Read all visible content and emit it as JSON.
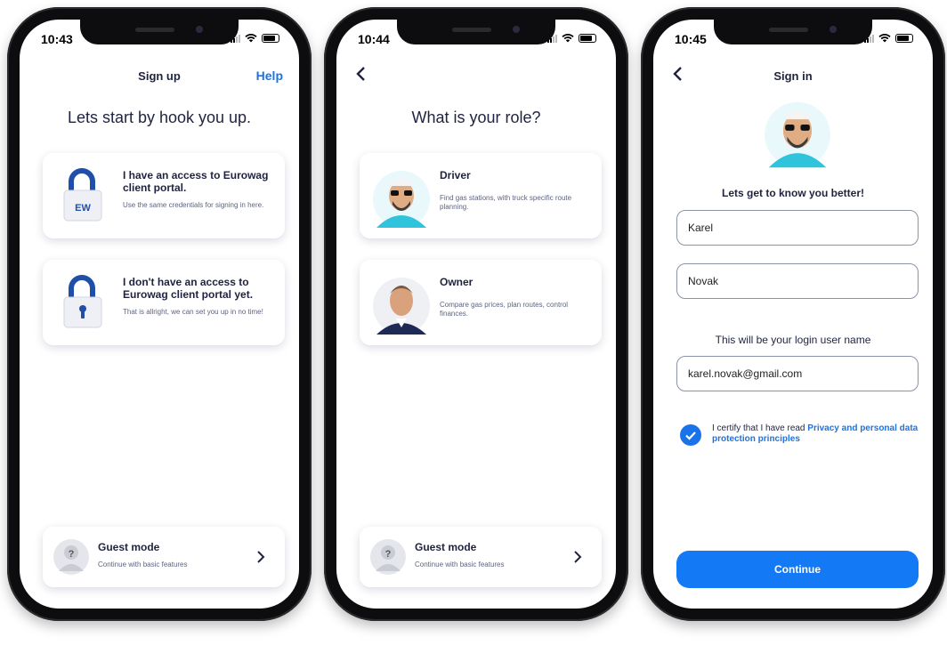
{
  "screens": [
    {
      "time": "10:43",
      "nav_title": "Sign up",
      "help": "Help",
      "heading": "Lets start by hook you up.",
      "cards": [
        {
          "title": "I have an access to Eurowag client portal.",
          "subtitle": "Use the same credentials for signing in here.",
          "icon": "padlock-eurowag-icon",
          "badge": "EW"
        },
        {
          "title": "I don't have an access to Eurowag client portal yet.",
          "subtitle": "That is allright, we can set you up in no time!",
          "icon": "padlock-icon"
        }
      ],
      "guest": {
        "title": "Guest mode",
        "subtitle": "Continue with basic features"
      }
    },
    {
      "time": "10:44",
      "heading": "What is your role?",
      "cards": [
        {
          "title": "Driver",
          "subtitle": "Find gas stations, with truck specific route planning.",
          "icon": "driver-avatar"
        },
        {
          "title": "Owner",
          "subtitle": "Compare gas prices, plan routes, control finances.",
          "icon": "owner-avatar"
        }
      ],
      "guest": {
        "title": "Guest mode",
        "subtitle": "Continue with basic features"
      }
    },
    {
      "time": "10:45",
      "nav_title": "Sign in",
      "subheading": "Lets get to know you better!",
      "first_name": "Karel",
      "last_name": "Novak",
      "login_note": "This will be your login user name",
      "email": "karel.novak@gmail.com",
      "certify_text": "I certify that I have read ",
      "certify_link": "Privacy and personal data protection principles",
      "continue": "Continue"
    }
  ],
  "colors": {
    "accent": "#1479f5",
    "text": "#1f2340",
    "link": "#1a73e8"
  }
}
